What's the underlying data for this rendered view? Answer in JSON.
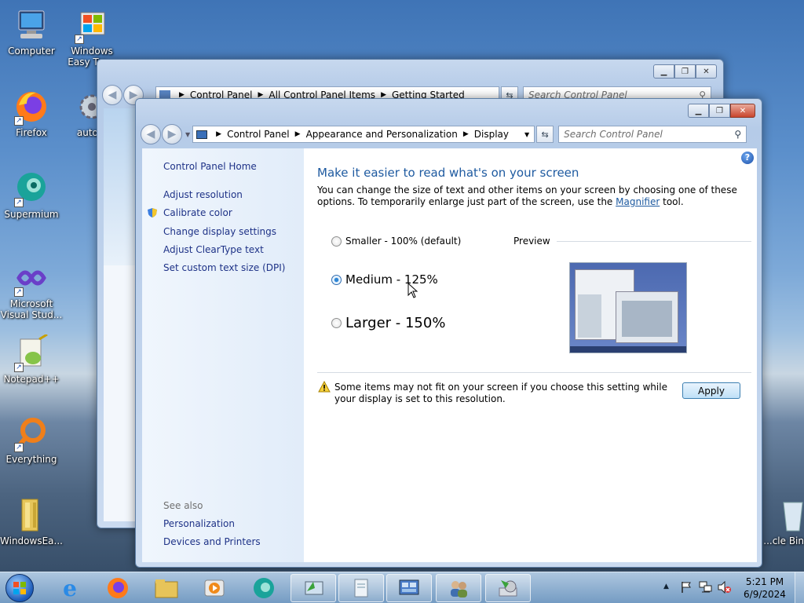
{
  "desktop": {
    "icons": [
      {
        "label": "Computer"
      },
      {
        "label": "Windows Easy Tra..."
      },
      {
        "label": "Firefox"
      },
      {
        "label": "auto..."
      },
      {
        "label": "Supermium"
      },
      {
        "label": "Microsoft Visual Stud..."
      },
      {
        "label": "Notepad++"
      },
      {
        "label": "Everything"
      },
      {
        "label": "WindowsEa..."
      },
      {
        "label": "...cle Bin"
      }
    ]
  },
  "back_window": {
    "breadcrumb": [
      "Control Panel",
      "All Control Panel Items",
      "Getting Started"
    ],
    "search_placeholder": "Search Control Panel"
  },
  "window": {
    "breadcrumb": [
      "Control Panel",
      "Appearance and Personalization",
      "Display"
    ],
    "search_placeholder": "Search Control Panel",
    "sidebar": {
      "home": "Control Panel Home",
      "links": [
        "Adjust resolution",
        "Calibrate color",
        "Change display settings",
        "Adjust ClearType text",
        "Set custom text size (DPI)"
      ],
      "see_also": "See also",
      "see_also_links": [
        "Personalization",
        "Devices and Printers"
      ]
    },
    "main": {
      "heading": "Make it easier to read what's on your screen",
      "desc_part1": "You can change the size of text and other items on your screen by choosing one of these options. To temporarily enlarge just part of the screen, use the",
      "desc_link": "Magnifier",
      "desc_part2": "tool.",
      "options": [
        {
          "label": "Smaller - 100% (default)",
          "selected": false
        },
        {
          "label": "Medium - 125%",
          "selected": true
        },
        {
          "label": "Larger - 150%",
          "selected": false
        }
      ],
      "preview_label": "Preview",
      "warning": "Some items may not fit on your screen if you choose this setting while your display is set to this resolution.",
      "apply_label": "Apply"
    }
  },
  "taskbar": {
    "time": "5:21 PM",
    "date": "6/9/2024"
  },
  "colors": {
    "link": "#1e3287",
    "heading": "#1e5aa0",
    "accent": "#3c7fb1"
  }
}
